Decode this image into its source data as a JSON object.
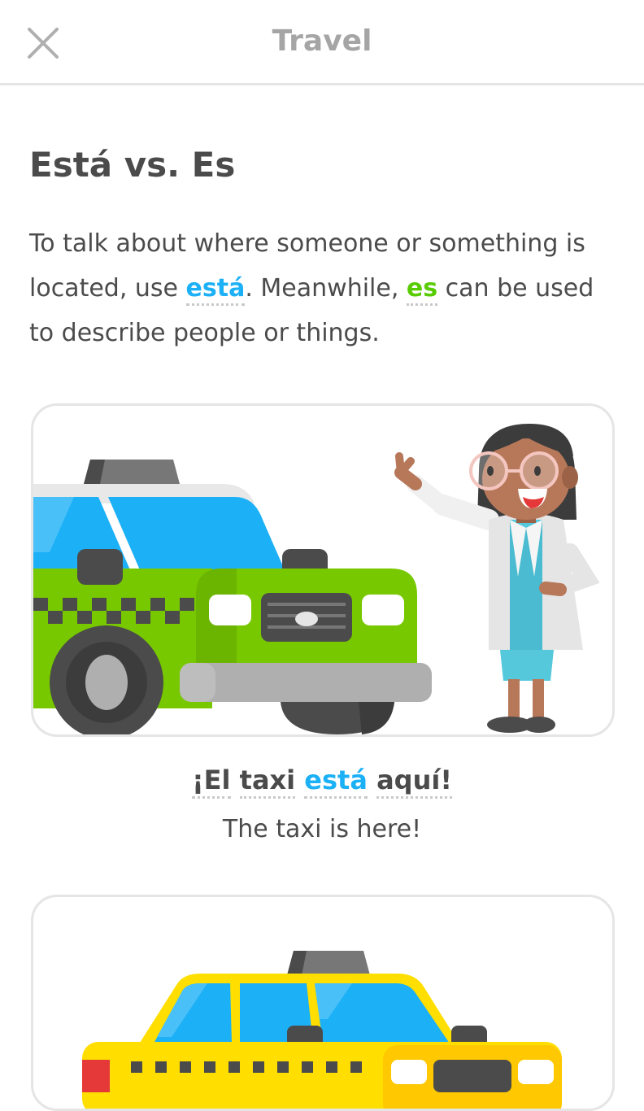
{
  "header": {
    "title": "Travel"
  },
  "lesson": {
    "heading": "Está vs. Es",
    "paragraph": {
      "part1": "To talk about where someone or something is located, use ",
      "kw1": "está",
      "part2": ". Meanwhile, ",
      "kw2": "es",
      "part3": " can be used to describe people or things."
    }
  },
  "examples": [
    {
      "words": [
        "¡El",
        "taxi",
        "está",
        "aquí!"
      ],
      "translation": "The taxi is here!"
    }
  ],
  "colors": {
    "accent_blue": "#1cb0f6",
    "accent_green": "#58cc02",
    "text": "#4b4b4b",
    "muted": "#a5a5a5",
    "border": "#e5e5e5"
  },
  "icons": {
    "close": "close-icon"
  }
}
